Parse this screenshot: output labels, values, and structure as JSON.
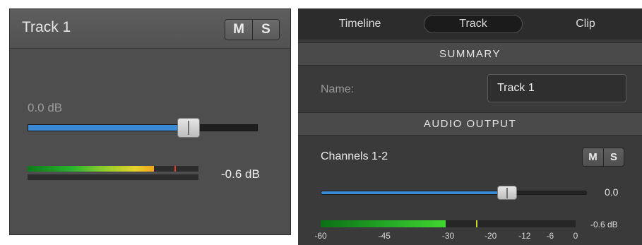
{
  "left_panel": {
    "track_title": "Track 1",
    "mute_label": "M",
    "solo_label": "S",
    "fader_db_label": "0.0 dB",
    "fader_level": 0.7,
    "meter_level": 0.74,
    "meter_peak_level": 0.86,
    "meter_db_label": "-0.6 dB"
  },
  "right_panel": {
    "tabs": [
      {
        "label": "Timeline",
        "selected": false
      },
      {
        "label": "Track",
        "selected": true
      },
      {
        "label": "Clip",
        "selected": false
      }
    ],
    "summary_header": "SUMMARY",
    "name_label": "Name:",
    "name_value": "Track 1",
    "audio_output_header": "AUDIO OUTPUT",
    "channels_label": "Channels 1-2",
    "mute_label": "M",
    "solo_label": "S",
    "fader_value": "0.0",
    "fader_level": 0.7,
    "meter_level": 0.49,
    "meter_peak_level": 0.61,
    "meter_db_label": "-0.6 dB",
    "meter_scale": [
      "-60",
      "-45",
      "-30",
      "-20",
      "-12",
      "-6",
      "0"
    ]
  },
  "colors": {
    "fader_fill": "#3a8ad6",
    "panel_bg": "#4e4e4e",
    "peak_red": "#e23c2c",
    "peak_yellow": "#cfd62c"
  }
}
